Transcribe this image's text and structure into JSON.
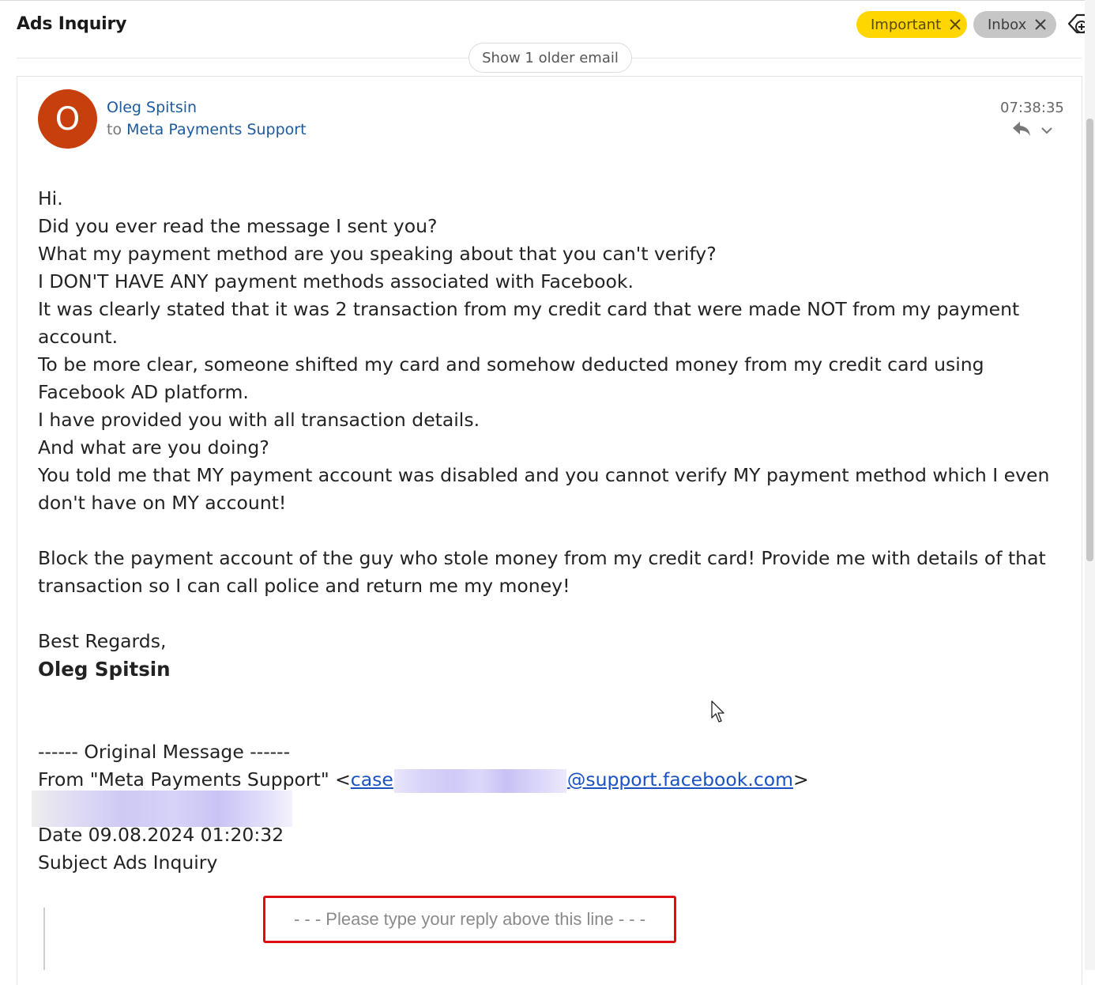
{
  "thread": {
    "subject": "Ads Inquiry",
    "tags": [
      {
        "label": "Important",
        "color": "#ffd600"
      },
      {
        "label": "Inbox",
        "color": "#c6c6c6"
      }
    ],
    "older_label": "Show 1 older email"
  },
  "message": {
    "avatar_initial": "O",
    "avatar_color": "#c73f0c",
    "sender": "Oleg Spitsin",
    "to_prefix": "to",
    "recipient": "Meta Payments Support",
    "time": "07:38:35",
    "body_lines": [
      "Hi.",
      "Did you ever read the message I sent you?",
      "What my payment method are you speaking about that you can't verify?",
      "I DON'T HAVE ANY payment methods associated with Facebook.",
      "It was clearly stated that it was 2 transaction from my credit card that were made NOT from my payment account.",
      "To be more clear, someone shifted my card and somehow deducted money from my credit card using Facebook AD platform.",
      "I have provided you with all transaction details.",
      "And what are you doing?",
      "You told me that MY payment account was disabled and you cannot verify MY payment method which I even don't have on MY account!"
    ],
    "body_paragraph2": "Block the payment account of the guy who stole money from my credit card! Provide me with details of that transaction so I can call police and return me my money!",
    "closing": "Best Regards,",
    "signature": "Oleg Spitsin",
    "original": {
      "header": "------ Original Message ------",
      "from_prefix": "From \"Meta Payments Support\" <",
      "from_link_start": "case",
      "from_link_end": "@support.facebook.com",
      "from_suffix": ">",
      "date_line": "Date 09.08.2024 01:20:32",
      "subject_line": "Subject Ads Inquiry"
    },
    "reply_marker": "- - - Please type your reply above this line - - -"
  }
}
